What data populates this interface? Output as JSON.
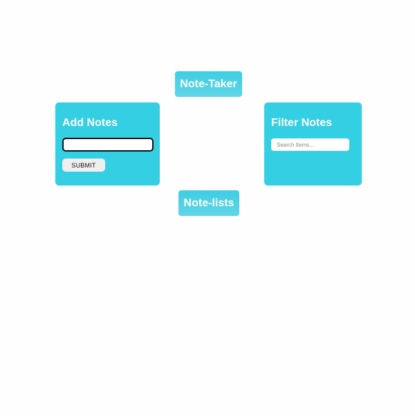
{
  "header": {
    "app_title": "Note-Taker"
  },
  "add_notes": {
    "heading": "Add Notes",
    "input_value": "",
    "submit_label": "SUBMIT"
  },
  "filter_notes": {
    "heading": "Filter Notes",
    "search_placeholder": "Search Items..."
  },
  "note_lists": {
    "title": "Note-lists"
  },
  "colors": {
    "accent": "#35cfe4",
    "page_background": "#fefefe",
    "button_background": "#efefef"
  }
}
